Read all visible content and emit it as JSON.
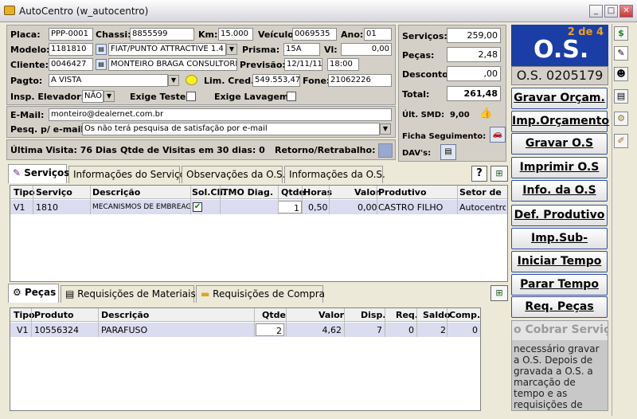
{
  "window": {
    "title": "AutoCentro (w_autocentro)"
  },
  "form": {
    "placa_label": "Placa:",
    "placa": "PPP-0001",
    "chassi_label": "Chassi:",
    "chassi": "8855599",
    "km_label": "Km:",
    "km": "15.000",
    "veiculo_label": "Veículo:",
    "veiculo": "0069535",
    "ano_label": "Ano:",
    "ano": "01",
    "modelo_label": "Modelo:",
    "modelo_code": "1181810",
    "modelo_desc": "FIAT/PUNTO ATTRACTIVE 1.4",
    "prisma_label": "Prisma:",
    "prisma": "15A",
    "vl_label": "Vl:",
    "vl": "0,00",
    "cliente_label": "Cliente:",
    "cliente_code": "0046427",
    "cliente_name": "MONTEIRO BRAGA CONSULTORIA",
    "previsao_label": "Previsão:",
    "previsao_date": "12/11/11",
    "previsao_time": "18:00",
    "pagto_label": "Pagto:",
    "pagto": "A VISTA",
    "lim_cred_label": "Lim. Cred.:",
    "lim_cred": "549.553,47",
    "fone_label": "Fone:",
    "fone": "21062226",
    "insp_label": "Insp. Elevador:",
    "insp": "NÃO",
    "exige_teste_label": "Exige Teste:",
    "exige_lavagem_label": "Exige Lavagem:",
    "email_label": "E-Mail:",
    "email": "monteiro@dealernet.com.br",
    "pesq_label": "Pesq. p/ e-mail:",
    "pesq": "Os não terá pesquisa de satisfação por e-mail",
    "ultima_visita": "Última Visita:  76 Dias",
    "qtde_visitas": "Qtde de Visitas em 30 dias:   0",
    "retorno": "Retorno/Retrabalho:"
  },
  "totals": {
    "servicos_label": "Serviços:",
    "servicos": "259,00",
    "pecas_label": "Peças:",
    "pecas": "2,48",
    "desconto_label": "Desconto:",
    "desconto": ",00",
    "total_label": "Total:",
    "total": "261,48",
    "smd_label": "Últ. SMD:",
    "smd": "9,00",
    "ficha_label": "Ficha  Seguimento:",
    "davs_label": "DAV's:"
  },
  "os": {
    "counter": "2 de 4",
    "title": "O.S.",
    "number": "O.S. 0205179"
  },
  "tabs_top": [
    "Serviços",
    "Informações do Serviço",
    "Observações da O.S.",
    "Informações da O.S."
  ],
  "help_label": "?",
  "services": {
    "headers": [
      "Tipo",
      "Serviço",
      "Descrição",
      "Sol.Cli.",
      "TMO Diag.",
      "Qtde",
      "Horas",
      "Valor",
      "Produtivo",
      "Setor de"
    ],
    "rows": [
      [
        "V1",
        "1810",
        "MECANISMOS DE EMBREAGEM",
        "",
        "",
        "1",
        "0,50",
        "0,00",
        "CASTRO FILHO",
        "Autocentro"
      ]
    ]
  },
  "tabs_bottom": [
    "Peças",
    "Requisições de Materiais",
    "Requisições de Compra"
  ],
  "parts": {
    "headers": [
      "Tipo",
      "Produto",
      "Descrição",
      "Qtde",
      "Valor",
      "Disp.",
      "Req.",
      "Saldo",
      "Comp."
    ],
    "rows": [
      [
        "V1",
        "10556324",
        "PARAFUSO",
        "2",
        "4,62",
        "7",
        "0",
        "2",
        "0"
      ]
    ]
  },
  "buttons": [
    "Gravar Orçam.",
    "Imp.Orçamento",
    "Gravar O.S",
    "Imprimir O.S",
    "Info. da O.S",
    "Def. Produtivo",
    "Imp.Sub-Ordem",
    "Iniciar Tempo",
    "Parar Tempo",
    "Req. Peças"
  ],
  "info_panel": {
    "title": "o Cobrar Serviç",
    "text": "necessário gravar a O.S. Depois de gravada a O.S. a marcação de tempo e as requisições de"
  },
  "colors": {
    "os_blue": "#1a3ea6",
    "counter_orange": "#f0a020",
    "selection": "#dcdcf0"
  }
}
